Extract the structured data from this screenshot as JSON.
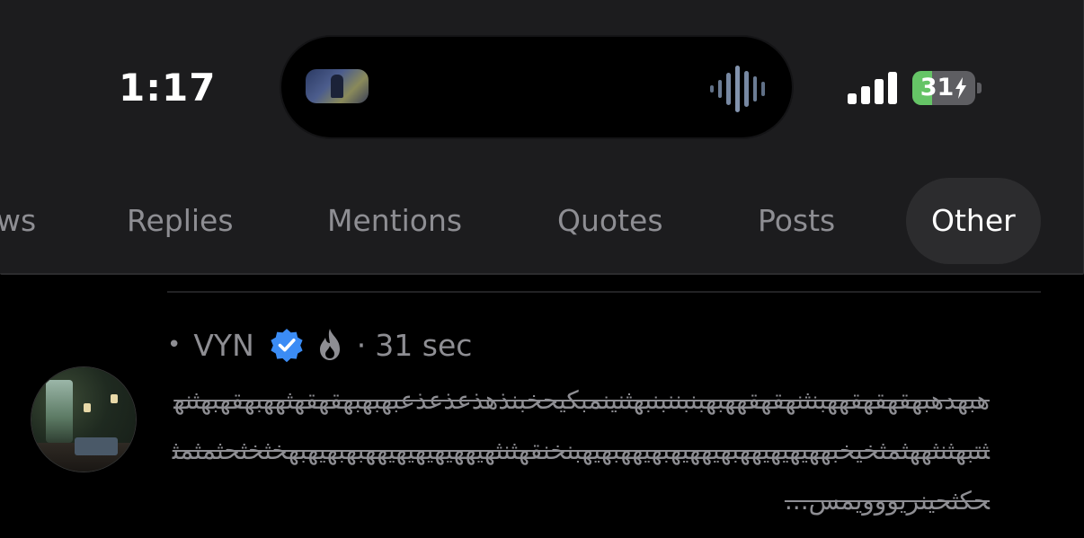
{
  "status_bar": {
    "time": "1:17",
    "battery_level": "31",
    "battery_fraction": 0.31,
    "signal_bars": 4,
    "colors": {
      "battery_fill": "#65c466",
      "battery_empty": "#5e5e62"
    }
  },
  "dynamic_island": {
    "album_art_icon": "album-art",
    "activity_icon": "waveform-icon"
  },
  "tabs": {
    "items": [
      {
        "label": "ws",
        "active": false
      },
      {
        "label": "Replies",
        "active": false
      },
      {
        "label": "Mentions",
        "active": false
      },
      {
        "label": "Quotes",
        "active": false
      },
      {
        "label": "Posts",
        "active": false
      },
      {
        "label": "Other",
        "active": true
      }
    ]
  },
  "post": {
    "bullet": "•",
    "username": "VYN",
    "verified_icon": "verified-badge-icon",
    "extra_icon": "flame-icon",
    "separator": "·",
    "timestamp": "31 sec",
    "body": "هبهدهبهقهقهقههبنثنهقهقههبهبنبننبنبهثنينمبكيحخبنذهذعذعذعبهبهبهقهقهثههبهقهبهثنهثتبهثنثههثمثخيخبههيهيهيههبهيههيهبهيههبهيهبنخنقهثنثهيههيهيهيهيههبهبهيهبهخثخثحثمثمثحكثحينريووويمس..."
  },
  "colors": {
    "panel_bg": "#1c1c1e",
    "active_tab_bg": "#2c2c2e",
    "muted_text": "#8e8e93",
    "verified_blue": "#3b8cf5"
  }
}
